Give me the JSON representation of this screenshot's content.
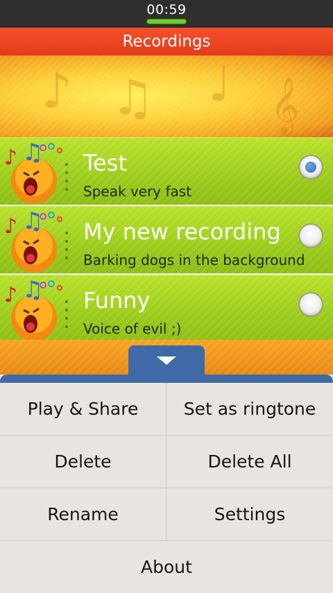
{
  "status_bar": {
    "time": "00:59"
  },
  "header": {
    "title": "Recordings"
  },
  "recordings": [
    {
      "title": "Test",
      "subtitle": "Speak very fast",
      "selected": true
    },
    {
      "title": "My new recording",
      "subtitle": "Barking dogs in the background",
      "selected": false
    },
    {
      "title": "Funny",
      "subtitle": "Voice of evil ;)",
      "selected": false
    }
  ],
  "menu": {
    "play_share": "Play & Share",
    "set_ringtone": "Set as ringtone",
    "delete": "Delete",
    "delete_all": "Delete All",
    "rename": "Rename",
    "settings": "Settings",
    "about": "About"
  },
  "icons": {
    "list_thumbnail": "singing-face-icon",
    "menu_handle": "chevron-down-icon"
  },
  "colors": {
    "title_bar": "#e84420",
    "list_row": "#a8d41f",
    "menu_handle": "#3f6aa6",
    "radio_selected": "#2e6db6"
  }
}
